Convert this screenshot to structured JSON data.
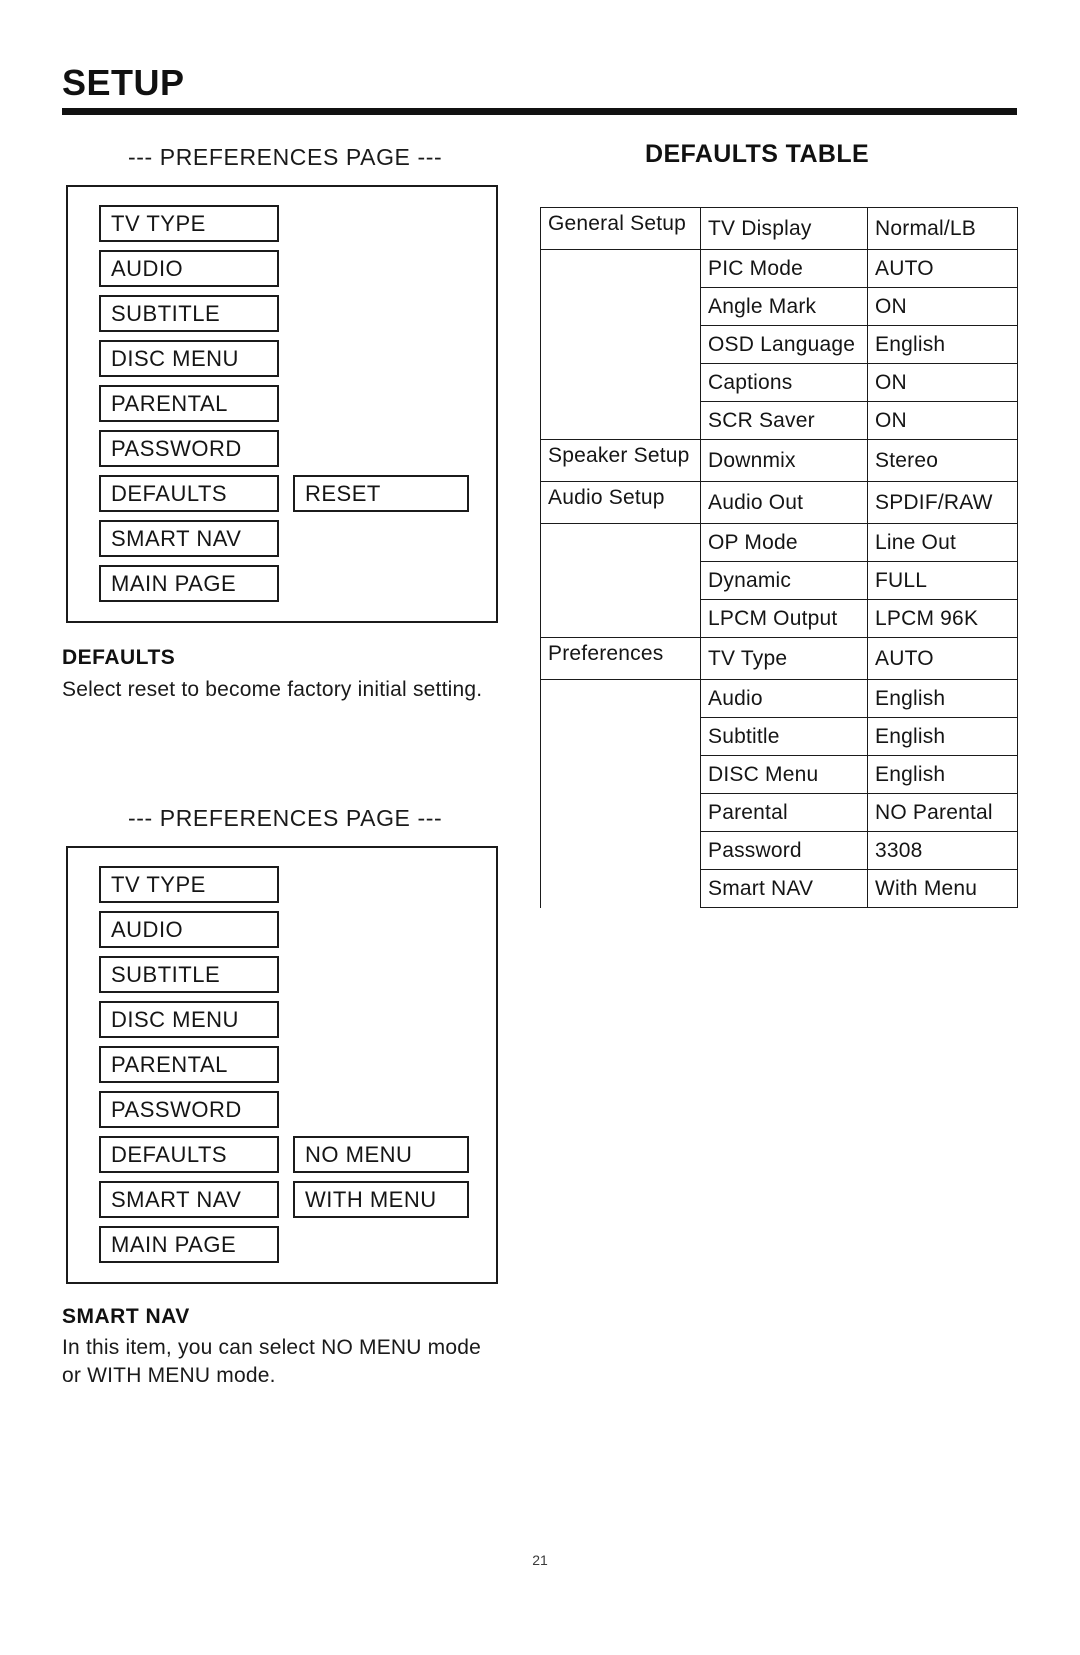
{
  "page": {
    "title": "SETUP",
    "number": "21"
  },
  "sections": {
    "prefs_caption_1": "--- PREFERENCES PAGE ---",
    "prefs_caption_2": "--- PREFERENCES PAGE ---",
    "defaults_table_title": "DEFAULTS TABLE"
  },
  "osd_menu_1": {
    "items": [
      "TV TYPE",
      "AUDIO",
      "SUBTITLE",
      "DISC MENU",
      "PARENTAL",
      "PASSWORD",
      "DEFAULTS",
      "SMART NAV",
      "MAIN PAGE"
    ],
    "submenu": [
      "RESET"
    ]
  },
  "osd_menu_2": {
    "items": [
      "TV TYPE",
      "AUDIO",
      "SUBTITLE",
      "DISC MENU",
      "PARENTAL",
      "PASSWORD",
      "DEFAULTS",
      "SMART NAV",
      "MAIN PAGE"
    ],
    "submenu": [
      "NO MENU",
      "WITH MENU"
    ]
  },
  "descriptions": {
    "defaults_heading": "DEFAULTS",
    "defaults_text": "Select reset to become factory initial setting.",
    "smartnav_heading": "SMART NAV",
    "smartnav_text": "In this item, you can select NO MENU mode or WITH MENU mode."
  },
  "defaults_table": {
    "rows": [
      {
        "group": "General Setup",
        "item": "TV Display",
        "value": "Normal/LB"
      },
      {
        "group": "",
        "item": "PIC Mode",
        "value": "AUTO"
      },
      {
        "group": "",
        "item": "Angle Mark",
        "value": "ON"
      },
      {
        "group": "",
        "item": "OSD Language",
        "value": "English"
      },
      {
        "group": "",
        "item": "Captions",
        "value": "ON"
      },
      {
        "group": "",
        "item": "SCR Saver",
        "value": "ON"
      },
      {
        "group": "Speaker Setup",
        "item": "Downmix",
        "value": "Stereo"
      },
      {
        "group": "Audio Setup",
        "item": "Audio Out",
        "value": "SPDIF/RAW"
      },
      {
        "group": "",
        "item": "OP Mode",
        "value": "Line Out"
      },
      {
        "group": "",
        "item": "Dynamic",
        "value": "FULL"
      },
      {
        "group": "",
        "item": "LPCM Output",
        "value": "LPCM 96K"
      },
      {
        "group": "Preferences",
        "item": "TV Type",
        "value": "AUTO"
      },
      {
        "group": "",
        "item": "Audio",
        "value": "English"
      },
      {
        "group": "",
        "item": "Subtitle",
        "value": "English"
      },
      {
        "group": "",
        "item": "DISC Menu",
        "value": "English"
      },
      {
        "group": "",
        "item": "Parental",
        "value": "NO Parental"
      },
      {
        "group": "",
        "item": "Password",
        "value": "3308"
      },
      {
        "group": "",
        "item": "Smart NAV",
        "value": "With Menu"
      }
    ]
  }
}
